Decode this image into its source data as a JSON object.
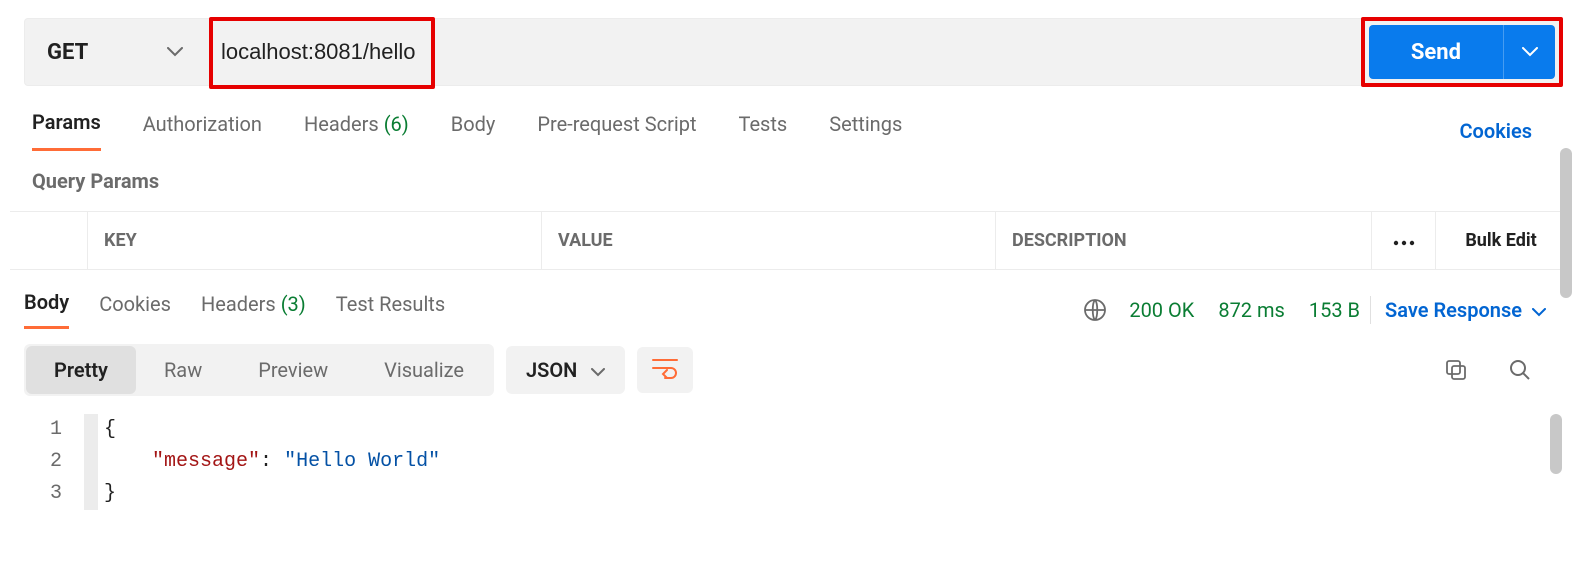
{
  "request": {
    "method": "GET",
    "url": "localhost:8081/hello",
    "send_label": "Send"
  },
  "request_tabs": {
    "params": "Params",
    "authorization": "Authorization",
    "headers": "Headers",
    "headers_count": "(6)",
    "body": "Body",
    "prerequest": "Pre-request Script",
    "tests": "Tests",
    "settings": "Settings",
    "cookies": "Cookies"
  },
  "query_params": {
    "title": "Query Params",
    "columns": {
      "key": "KEY",
      "value": "VALUE",
      "description": "DESCRIPTION"
    },
    "bulk_edit": "Bulk Edit"
  },
  "response_tabs": {
    "body": "Body",
    "cookies": "Cookies",
    "headers": "Headers",
    "headers_count": "(3)",
    "test_results": "Test Results"
  },
  "status": {
    "code": "200 OK",
    "time": "872 ms",
    "size": "153 B",
    "save_response": "Save Response"
  },
  "body_view": {
    "pretty": "Pretty",
    "raw": "Raw",
    "preview": "Preview",
    "visualize": "Visualize",
    "format": "JSON"
  },
  "json_body": {
    "line1_num": "1",
    "line2_num": "2",
    "line3_num": "3",
    "open_brace": "{",
    "key": "\"message\"",
    "colon": ": ",
    "value": "\"Hello World\"",
    "close_brace": "}",
    "indent": "    "
  }
}
